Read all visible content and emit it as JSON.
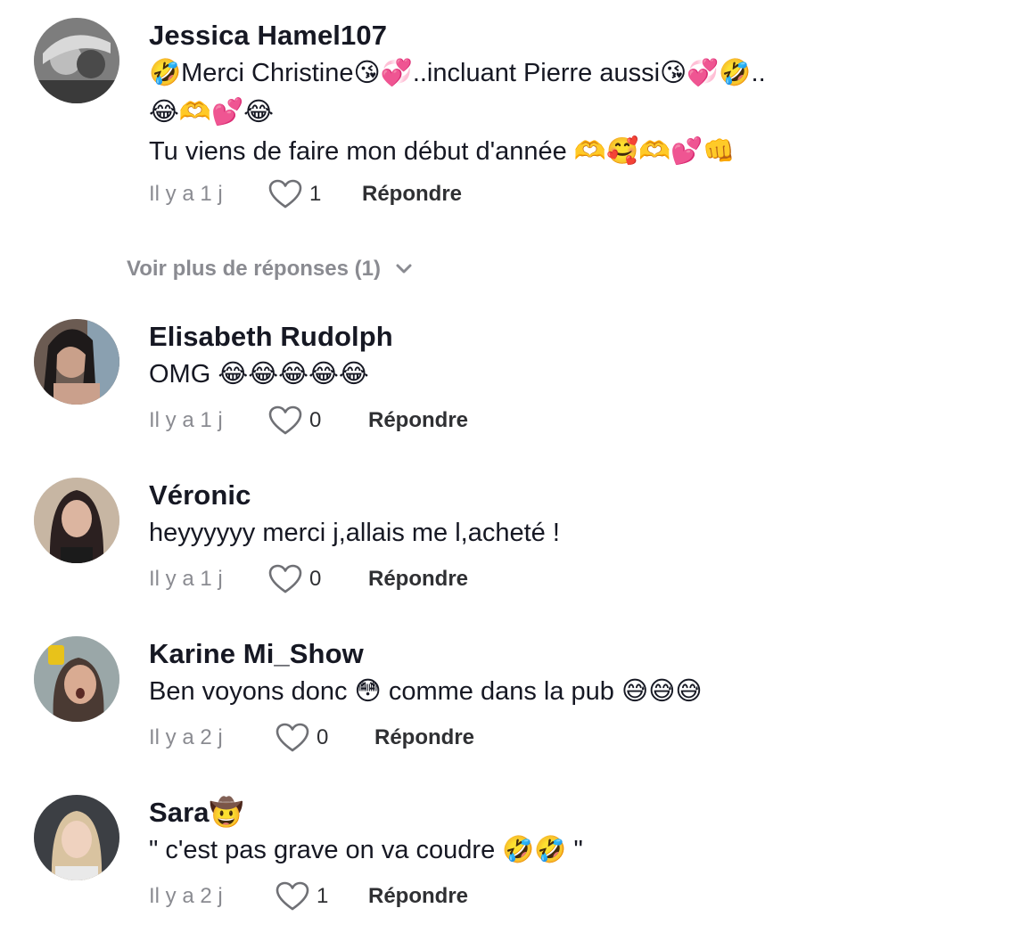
{
  "colors": {
    "text_primary": "#161823",
    "text_secondary": "#8a8b91",
    "action": "#2f3033"
  },
  "comments": [
    {
      "username": "Jessica Hamel107",
      "lines": [
        "🤣Merci Christine😘💞..incluant Pierre aussi😘💞🤣..",
        "😂🫶💕😂",
        "Tu viens de faire mon début d'année 🫶🥰🫶💕👊"
      ],
      "time": "Il y a 1 j",
      "likes": "1",
      "reply_label": "Répondre",
      "like_icon": "heart-outline-icon"
    },
    {
      "username": "Elisabeth Rudolph",
      "lines": [
        "OMG 😂😂😂😂😂"
      ],
      "time": "Il y a 1 j",
      "likes": "0",
      "reply_label": "Répondre",
      "like_icon": "heart-outline-icon"
    },
    {
      "username": "Véronic",
      "lines": [
        "heyyyyyy merci j,allais me l,acheté !"
      ],
      "time": "Il y a 1 j",
      "likes": "0",
      "reply_label": "Répondre",
      "like_icon": "heart-outline-icon"
    },
    {
      "username": "Karine Mi_Show",
      "lines": [
        "Ben voyons donc 😳 comme dans la pub 😅😅😅"
      ],
      "time": "Il y a 2 j",
      "likes": "0",
      "reply_label": "Répondre",
      "like_icon": "heart-outline-icon"
    },
    {
      "username": "Sara🤠",
      "lines": [
        "\" c'est pas grave on va coudre 🤣🤣 \""
      ],
      "time": "Il y a 2 j",
      "likes": "1",
      "reply_label": "Répondre",
      "like_icon": "heart-outline-icon"
    }
  ],
  "more_replies": {
    "label": "Voir plus de réponses (1)",
    "icon": "chevron-down-icon"
  }
}
